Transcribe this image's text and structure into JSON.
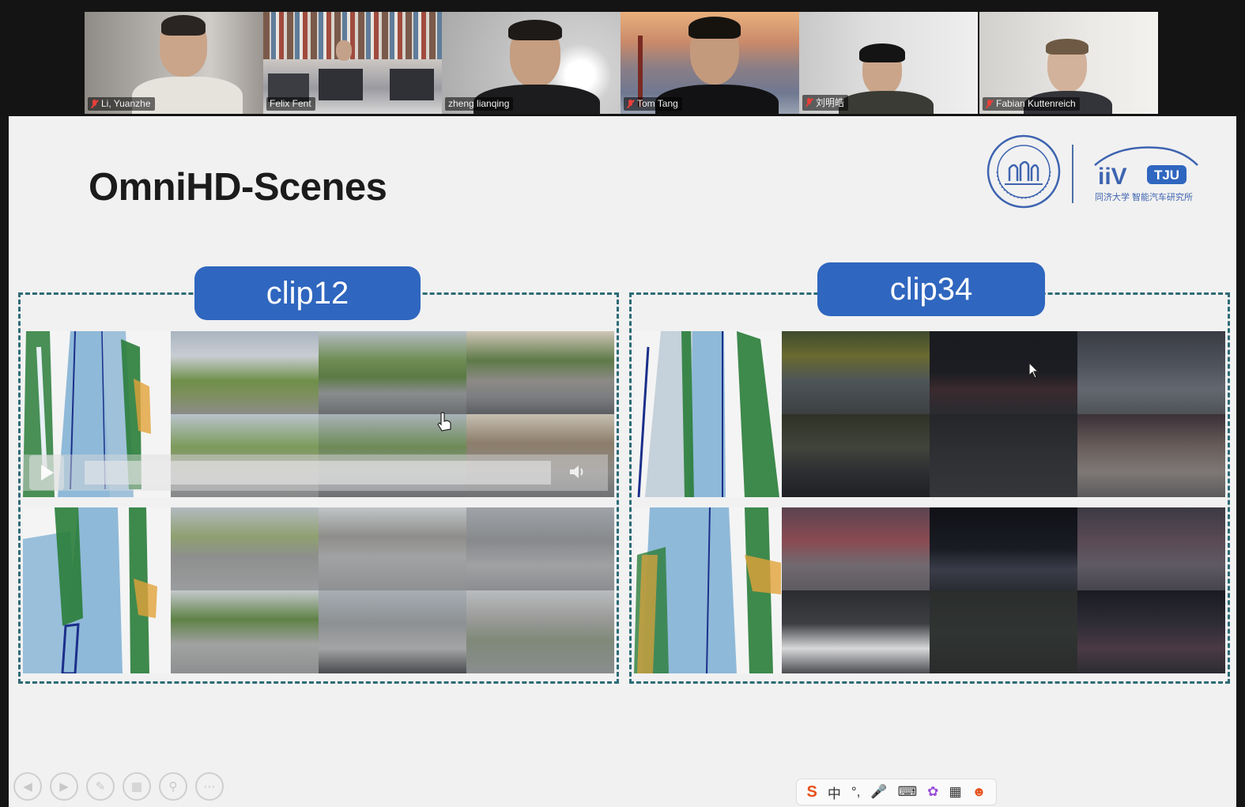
{
  "participants": [
    {
      "name": "Li, Yuanzhe",
      "muted": true,
      "active": false
    },
    {
      "name": "Felix Fent",
      "muted": false,
      "active": false
    },
    {
      "name": "zheng lianqing",
      "muted": false,
      "active": true
    },
    {
      "name": "Tom Tang",
      "muted": true,
      "active": false
    },
    {
      "name": "刘明皓",
      "muted": true,
      "active": false
    },
    {
      "name": "Fabian Kuttenreich",
      "muted": true,
      "active": false
    }
  ],
  "slide": {
    "title": "OmniHD-Scenes",
    "clips": [
      {
        "label": "clip12",
        "lighting": "day"
      },
      {
        "label": "clip34",
        "lighting": "night"
      }
    ],
    "logo_right_text": "TJU",
    "logo_right_caption": "同济大学 智能汽车研究所"
  },
  "video_player": {
    "state": "paused"
  },
  "slide_controls": [
    "previous",
    "next",
    "pen",
    "slides",
    "zoom",
    "more"
  ],
  "ime_toolbar": {
    "items": [
      "S",
      "中",
      "°,",
      "mic",
      "keyboard",
      "skin",
      "apps",
      "mascot"
    ],
    "mode_label": "中",
    "punct_label": "°,"
  },
  "colors": {
    "pill": "#2f66bf",
    "dash": "#2e6b78",
    "active_speaker": "#3ccf6e",
    "muted_mic": "#e8403a"
  }
}
